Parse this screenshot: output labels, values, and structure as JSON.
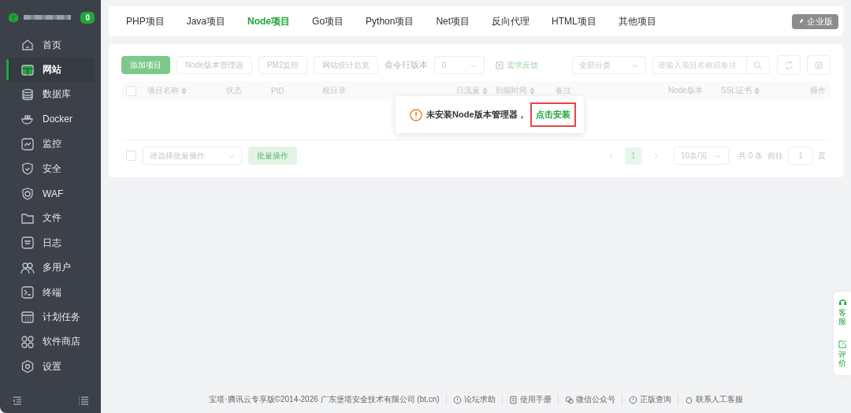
{
  "sidebar": {
    "badge": "0",
    "items": [
      {
        "label": "首页",
        "selected": false
      },
      {
        "label": "网站",
        "selected": true
      },
      {
        "label": "数据库",
        "selected": false
      },
      {
        "label": "Docker",
        "selected": false
      },
      {
        "label": "监控",
        "selected": false
      },
      {
        "label": "安全",
        "selected": false
      },
      {
        "label": "WAF",
        "selected": false
      },
      {
        "label": "文件",
        "selected": false
      },
      {
        "label": "日志",
        "selected": false
      },
      {
        "label": "多用户",
        "selected": false
      },
      {
        "label": "终端",
        "selected": false
      },
      {
        "label": "计划任务",
        "selected": false
      },
      {
        "label": "软件商店",
        "selected": false
      },
      {
        "label": "设置",
        "selected": false
      }
    ]
  },
  "tabs": [
    {
      "label": "PHP项目",
      "selected": false
    },
    {
      "label": "Java项目",
      "selected": false
    },
    {
      "label": "Node项目",
      "selected": true
    },
    {
      "label": "Go项目",
      "selected": false
    },
    {
      "label": "Python项目",
      "selected": false
    },
    {
      "label": "Net项目",
      "selected": false
    },
    {
      "label": "反向代理",
      "selected": false
    },
    {
      "label": "HTML项目",
      "selected": false
    },
    {
      "label": "其他项目",
      "selected": false
    }
  ],
  "edition_badge": "企业版",
  "toolbar": {
    "buttons": [
      {
        "label": "添加项目",
        "kind": "primary"
      },
      {
        "label": "Node版本管理器",
        "kind": "plain"
      },
      {
        "label": "PM2监控",
        "kind": "plain"
      },
      {
        "label": "网站统计总览",
        "kind": "plain"
      }
    ],
    "cli_label": "命令行版本",
    "cli_value": "0",
    "feedback": "需求反馈",
    "category": "全部分类",
    "search": {
      "placeholder": "请输入项目名称或备注"
    }
  },
  "table": {
    "select_all": {
      "checked": false
    },
    "columns": [
      {
        "label": "项目名称",
        "sortable": true
      },
      {
        "label": "状态",
        "sortable": false
      },
      {
        "label": "PID",
        "sortable": false
      },
      {
        "label": "根目录",
        "sortable": false
      },
      {
        "label": "日流量",
        "sortable": true
      },
      {
        "label": "到期时间",
        "sortable": true
      },
      {
        "label": "备注",
        "sortable": false
      },
      {
        "label": "Node版本",
        "sortable": false
      },
      {
        "label": "SSL证书",
        "sortable": true
      },
      {
        "label": "操作",
        "sortable": false
      }
    ]
  },
  "batch": {
    "checked": false,
    "placeholder": "请选择批量操作",
    "button": "批量操作"
  },
  "pager": {
    "page": "1",
    "size": "10条/页",
    "total": "共 0 条",
    "goto": "前往",
    "goto_value": "1",
    "unit": "页"
  },
  "message": {
    "text": "未安装Node版本管理器，",
    "link": "点击安装"
  },
  "footer": {
    "copyright": "宝塔·腾讯云专享版©2014-2026 广东堡塔安全技术有限公司 (bt.cn)",
    "links": [
      "论坛求助",
      "使用手册",
      "微信公众号",
      "正版查询",
      "联系人工客服"
    ]
  },
  "float": [
    "客服",
    "评价"
  ]
}
